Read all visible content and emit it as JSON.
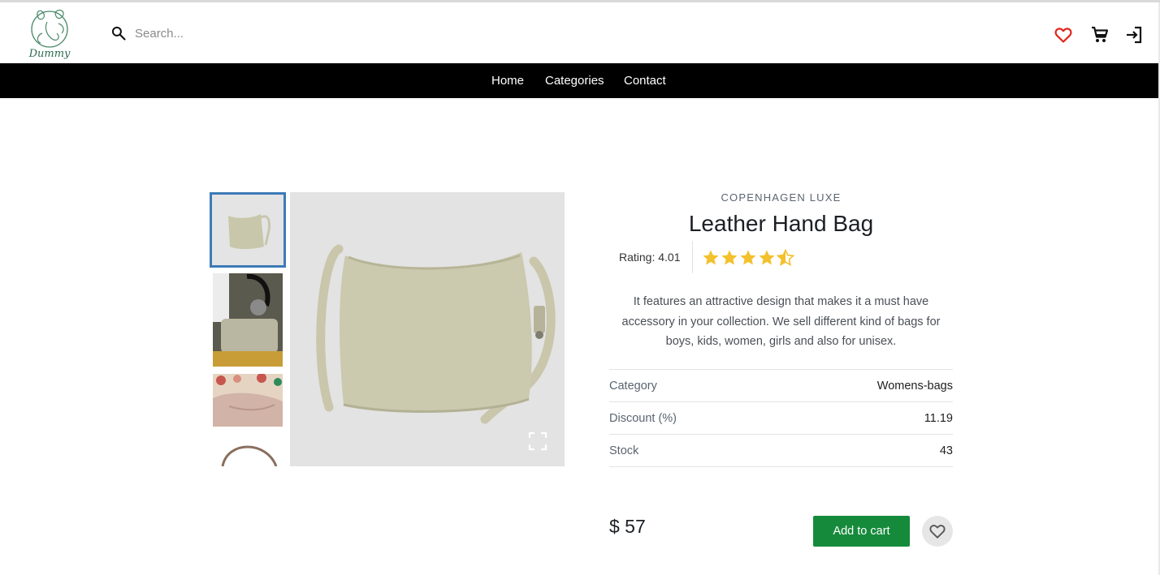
{
  "header": {
    "logo_text": "Dummy",
    "search_placeholder": "Search...",
    "icons": {
      "favorites": "heart-outline-icon",
      "cart": "shopping-cart-icon",
      "login": "login-icon"
    },
    "accent_heart": "#e0251b"
  },
  "nav": {
    "items": [
      "Home",
      "Categories",
      "Contact"
    ]
  },
  "product": {
    "brand": "COPENHAGEN LUXE",
    "title": "Leather Hand Bag",
    "rating_label": "Rating: 4.01",
    "rating": 4.01,
    "description": "It features an attractive design that makes it a must have accessory in your collection. We sell different kind of bags for boys, kids, women, girls and also for unisex.",
    "specs": [
      {
        "key": "Category",
        "value": "Womens-bags"
      },
      {
        "key": "Discount (%)",
        "value": "11.19"
      },
      {
        "key": "Stock",
        "value": "43"
      }
    ],
    "price": "$ 57",
    "add_to_cart": "Add to cart",
    "thumbnail_count": 4,
    "selected_thumbnail": 0
  },
  "colors": {
    "nav_bg": "#000000",
    "button_green": "#168a3b",
    "thumb_selected_border": "#3d7ab8",
    "star": "#f3c12c"
  }
}
